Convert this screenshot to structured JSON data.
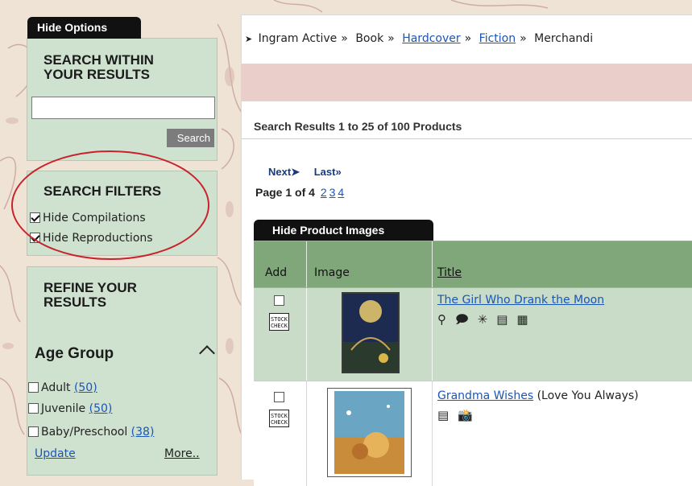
{
  "sidebar": {
    "hide_options": "Hide Options",
    "search_within": {
      "title_line1": "SEARCH WITHIN",
      "title_line2": "YOUR RESULTS",
      "input_value": "",
      "button": "Search"
    },
    "filters": {
      "title": "SEARCH FILTERS",
      "items": [
        {
          "label": "Hide Compilations",
          "checked": true
        },
        {
          "label": "Hide Reproductions",
          "checked": true
        }
      ]
    },
    "refine": {
      "title_line1": "REFINE YOUR",
      "title_line2": "RESULTS",
      "age_group": "Age Group",
      "options": [
        {
          "label": "Adult",
          "count": "(50)"
        },
        {
          "label": "Juvenile",
          "count": "(50)"
        },
        {
          "label": "Baby/Preschool",
          "count": "(38)"
        }
      ],
      "update": "Update",
      "more": "More.."
    }
  },
  "breadcrumb": {
    "items": [
      "Ingram Active",
      "Book",
      "Hardcover",
      "Fiction",
      "Merchandi"
    ],
    "separator": "»"
  },
  "results": {
    "summary": "Search Results 1 to 25 of 100 Products",
    "next": "Next",
    "last": "Last",
    "page_label": "Page 1 of 4",
    "pages": [
      "2",
      "3",
      "4"
    ],
    "hide_images": "Hide Product Images",
    "columns": {
      "add": "Add",
      "image": "Image",
      "title": "Title"
    },
    "stock_check": "STOCK CHECK",
    "products": [
      {
        "title": "The Girl Who Drank the Moon",
        "subtitle": "",
        "icons": [
          "trophy-icon",
          "speech-bubble-icon",
          "review-star-icon",
          "document-icon",
          "excerpt-icon"
        ]
      },
      {
        "title": "Grandma Wishes",
        "subtitle": "(Love You Always)",
        "icons": [
          "document-icon",
          "camera-flash-icon"
        ]
      }
    ]
  },
  "colors": {
    "sidebar_panel": "#cfe1cf",
    "table_header": "#7fa77a",
    "selected_row": "#c8dcc8",
    "highlight_oval": "#c8232b",
    "link": "#1a55b8"
  }
}
